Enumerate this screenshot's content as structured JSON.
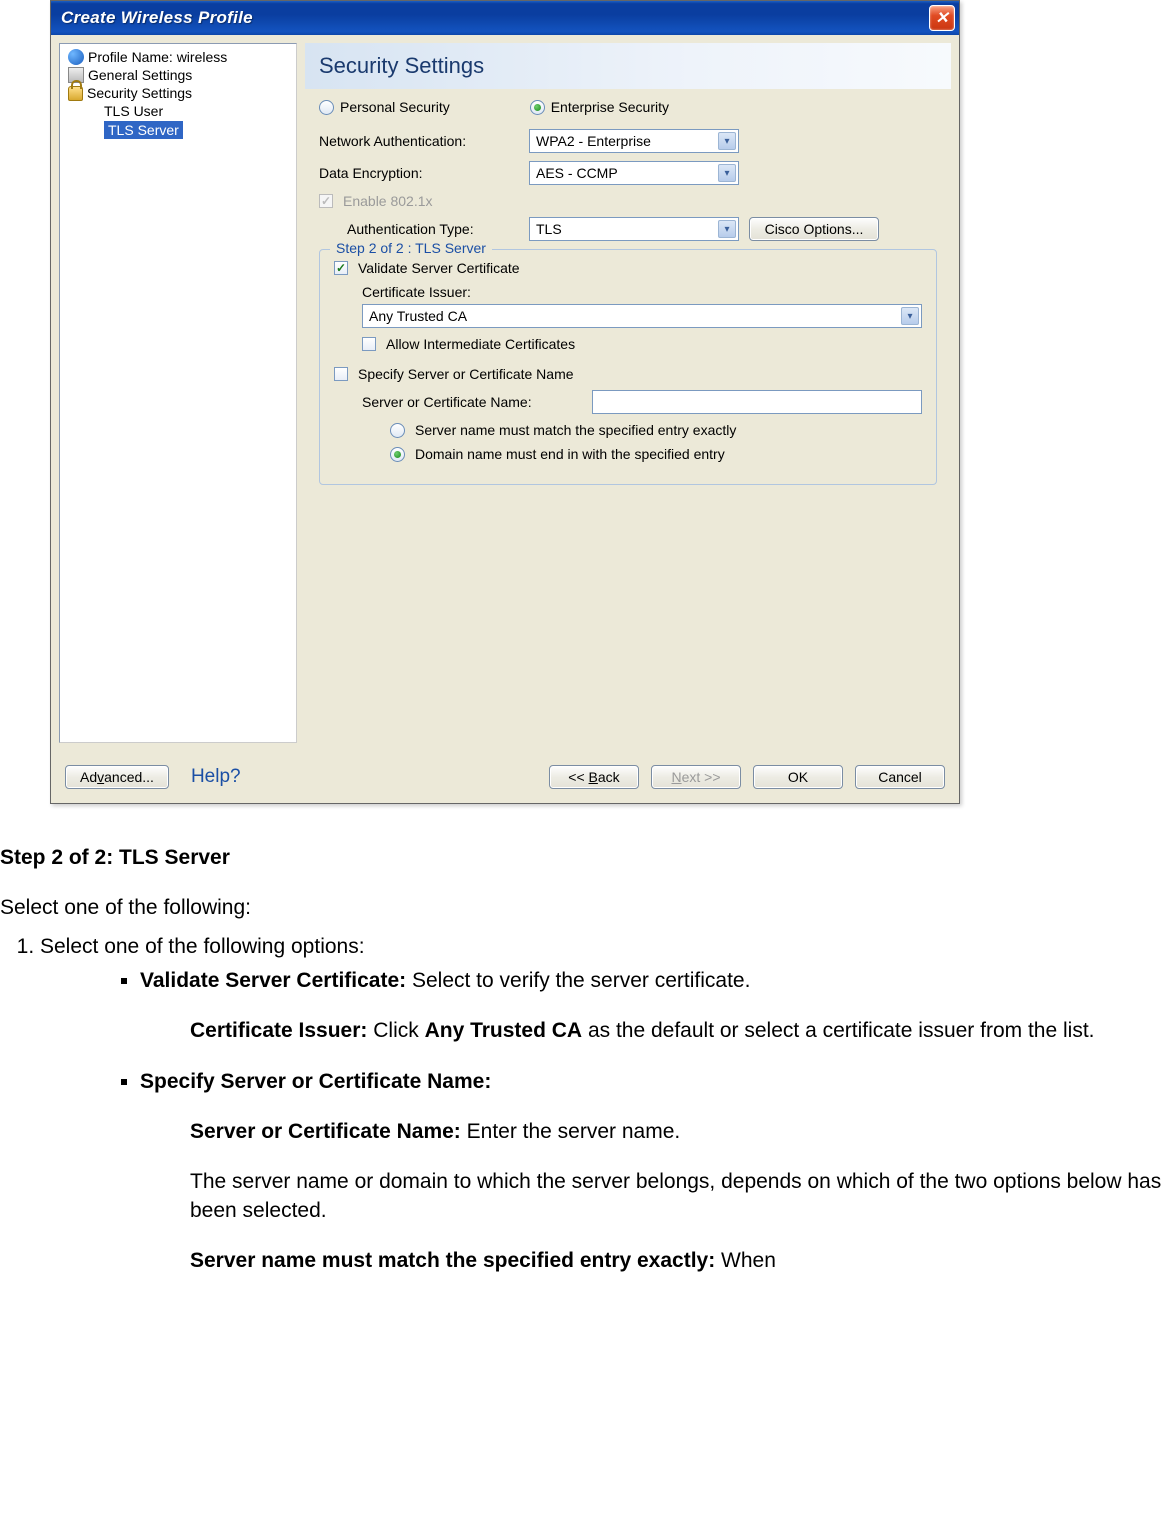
{
  "window": {
    "title": "Create Wireless Profile"
  },
  "tree": {
    "profile_name_label": "Profile Name: wireless",
    "general_settings": "General Settings",
    "security_settings": "Security Settings",
    "tls_user": "TLS User",
    "tls_server": "TLS Server"
  },
  "header": {
    "title": "Security Settings"
  },
  "security_mode": {
    "personal": "Personal Security",
    "enterprise": "Enterprise Security"
  },
  "fields": {
    "network_auth_label": "Network Authentication:",
    "network_auth_value": "WPA2 - Enterprise",
    "data_encryption_label": "Data Encryption:",
    "data_encryption_value": "AES - CCMP",
    "enable_8021x": "Enable 802.1x",
    "auth_type_label": "Authentication Type:",
    "auth_type_value": "TLS",
    "cisco_options": "Cisco Options..."
  },
  "step_group": {
    "legend": "Step 2 of 2 : TLS Server",
    "validate_cert": "Validate Server Certificate",
    "cert_issuer_label": "Certificate Issuer:",
    "cert_issuer_value": "Any Trusted CA",
    "allow_intermediate": "Allow Intermediate Certificates",
    "specify_name": "Specify Server or Certificate Name",
    "server_name_label": "Server or Certificate Name:",
    "server_name_value": "",
    "match_exact": "Server name must match the specified entry exactly",
    "match_domain": "Domain name must end in with the specified entry"
  },
  "buttons": {
    "advanced": "Advanced...",
    "help": "Help?",
    "back": "<< Back",
    "next": "Next >>",
    "ok": "OK",
    "cancel": "Cancel"
  },
  "doc": {
    "heading": "Step 2 of 2: TLS Server",
    "intro": "Select one of the following:",
    "li1": "Select one of the following options:",
    "bullet1_bold": "Validate Server Certificate:",
    "bullet1_rest": " Select to verify the server certificate.",
    "cert_issuer_bold": "Certificate Issuer:",
    "cert_issuer_mid": " Click ",
    "cert_issuer_bold2": "Any Trusted CA",
    "cert_issuer_rest": " as the default or select a certificate issuer from the list.",
    "bullet2_bold": "Specify Server or Certificate Name:",
    "srv_name_bold": "Server or Certificate Name:",
    "srv_name_rest": " Enter the server name.",
    "srv_desc": "The server name or domain to which the server belongs, depends on which of the two options below has been selected.",
    "match_exact_bold": "Server name must match the specified entry exactly:",
    "match_exact_rest": " When"
  }
}
